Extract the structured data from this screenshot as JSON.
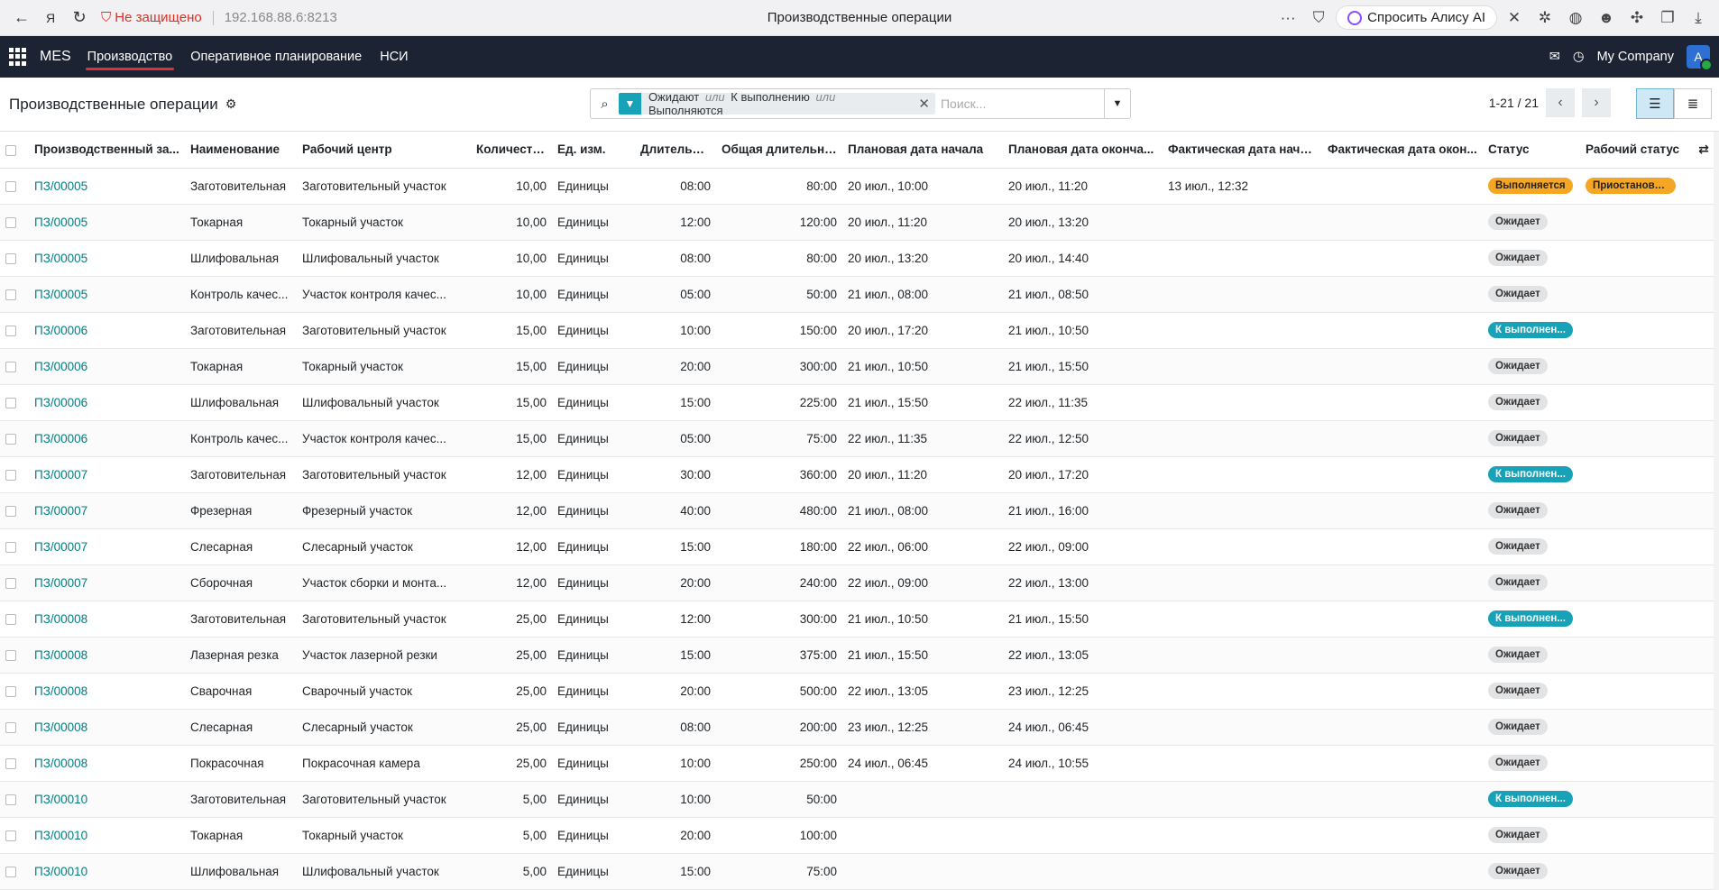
{
  "browser": {
    "not_secure": "Не защищено",
    "url": "192.168.88.6:8213",
    "tab_title": "Производственные операции",
    "alice": "Спросить Алису AI"
  },
  "nav": {
    "brand": "MES",
    "items": [
      "Производство",
      "Оперативное планирование",
      "НСИ"
    ],
    "company": "My Company",
    "avatar": "A"
  },
  "control": {
    "title": "Производственные операции",
    "facet": [
      "Ожидают",
      "К выполнению",
      "Выполняются"
    ],
    "facet_or": "или",
    "search_placeholder": "Поиск...",
    "pager": "1-21 / 21"
  },
  "columns": [
    "Производственный за...",
    "Наименование",
    "Рабочий центр",
    "Количество",
    "Ед. изм.",
    "Длительно...",
    "Общая длительно...",
    "Плановая дата начала",
    "Плановая дата оконча...",
    "Фактическая дата начала",
    "Фактическая дата окон...",
    "Статус",
    "Рабочий статус"
  ],
  "rows": [
    {
      "order": "ПЗ/00005",
      "name": "Заготовительная",
      "wc": "Заготовительный участок",
      "qty": "10,00",
      "uom": "Единицы",
      "dur": "08:00",
      "total": "80:00",
      "ps": "20 июл., 10:00",
      "pe": "20 июл., 11:20",
      "as": "13 июл., 12:32",
      "ae": "",
      "status": "Выполняется",
      "st": "warn",
      "work": "Приостановл..."
    },
    {
      "order": "ПЗ/00005",
      "name": "Токарная",
      "wc": "Токарный участок",
      "qty": "10,00",
      "uom": "Единицы",
      "dur": "12:00",
      "total": "120:00",
      "ps": "20 июл., 11:20",
      "pe": "20 июл., 13:20",
      "as": "",
      "ae": "",
      "status": "Ожидает",
      "st": "muted",
      "work": ""
    },
    {
      "order": "ПЗ/00005",
      "name": "Шлифовальная",
      "wc": "Шлифовальный участок",
      "qty": "10,00",
      "uom": "Единицы",
      "dur": "08:00",
      "total": "80:00",
      "ps": "20 июл., 13:20",
      "pe": "20 июл., 14:40",
      "as": "",
      "ae": "",
      "status": "Ожидает",
      "st": "muted",
      "work": ""
    },
    {
      "order": "ПЗ/00005",
      "name": "Контроль качес...",
      "wc": "Участок контроля качес...",
      "qty": "10,00",
      "uom": "Единицы",
      "dur": "05:00",
      "total": "50:00",
      "ps": "21 июл., 08:00",
      "pe": "21 июл., 08:50",
      "as": "",
      "ae": "",
      "status": "Ожидает",
      "st": "muted",
      "work": ""
    },
    {
      "order": "ПЗ/00006",
      "name": "Заготовительная",
      "wc": "Заготовительный участок",
      "qty": "15,00",
      "uom": "Единицы",
      "dur": "10:00",
      "total": "150:00",
      "ps": "20 июл., 17:20",
      "pe": "21 июл., 10:50",
      "as": "",
      "ae": "",
      "status": "К выполнен...",
      "st": "info",
      "work": ""
    },
    {
      "order": "ПЗ/00006",
      "name": "Токарная",
      "wc": "Токарный участок",
      "qty": "15,00",
      "uom": "Единицы",
      "dur": "20:00",
      "total": "300:00",
      "ps": "21 июл., 10:50",
      "pe": "21 июл., 15:50",
      "as": "",
      "ae": "",
      "status": "Ожидает",
      "st": "muted",
      "work": ""
    },
    {
      "order": "ПЗ/00006",
      "name": "Шлифовальная",
      "wc": "Шлифовальный участок",
      "qty": "15,00",
      "uom": "Единицы",
      "dur": "15:00",
      "total": "225:00",
      "ps": "21 июл., 15:50",
      "pe": "22 июл., 11:35",
      "as": "",
      "ae": "",
      "status": "Ожидает",
      "st": "muted",
      "work": ""
    },
    {
      "order": "ПЗ/00006",
      "name": "Контроль качес...",
      "wc": "Участок контроля качес...",
      "qty": "15,00",
      "uom": "Единицы",
      "dur": "05:00",
      "total": "75:00",
      "ps": "22 июл., 11:35",
      "pe": "22 июл., 12:50",
      "as": "",
      "ae": "",
      "status": "Ожидает",
      "st": "muted",
      "work": ""
    },
    {
      "order": "ПЗ/00007",
      "name": "Заготовительная",
      "wc": "Заготовительный участок",
      "qty": "12,00",
      "uom": "Единицы",
      "dur": "30:00",
      "total": "360:00",
      "ps": "20 июл., 11:20",
      "pe": "20 июл., 17:20",
      "as": "",
      "ae": "",
      "status": "К выполнен...",
      "st": "info",
      "work": ""
    },
    {
      "order": "ПЗ/00007",
      "name": "Фрезерная",
      "wc": "Фрезерный участок",
      "qty": "12,00",
      "uom": "Единицы",
      "dur": "40:00",
      "total": "480:00",
      "ps": "21 июл., 08:00",
      "pe": "21 июл., 16:00",
      "as": "",
      "ae": "",
      "status": "Ожидает",
      "st": "muted",
      "work": ""
    },
    {
      "order": "ПЗ/00007",
      "name": "Слесарная",
      "wc": "Слесарный участок",
      "qty": "12,00",
      "uom": "Единицы",
      "dur": "15:00",
      "total": "180:00",
      "ps": "22 июл., 06:00",
      "pe": "22 июл., 09:00",
      "as": "",
      "ae": "",
      "status": "Ожидает",
      "st": "muted",
      "work": ""
    },
    {
      "order": "ПЗ/00007",
      "name": "Сборочная",
      "wc": "Участок сборки и монта...",
      "qty": "12,00",
      "uom": "Единицы",
      "dur": "20:00",
      "total": "240:00",
      "ps": "22 июл., 09:00",
      "pe": "22 июл., 13:00",
      "as": "",
      "ae": "",
      "status": "Ожидает",
      "st": "muted",
      "work": ""
    },
    {
      "order": "ПЗ/00008",
      "name": "Заготовительная",
      "wc": "Заготовительный участок",
      "qty": "25,00",
      "uom": "Единицы",
      "dur": "12:00",
      "total": "300:00",
      "ps": "21 июл., 10:50",
      "pe": "21 июл., 15:50",
      "as": "",
      "ae": "",
      "status": "К выполнен...",
      "st": "info",
      "work": ""
    },
    {
      "order": "ПЗ/00008",
      "name": "Лазерная резка",
      "wc": "Участок лазерной резки",
      "qty": "25,00",
      "uom": "Единицы",
      "dur": "15:00",
      "total": "375:00",
      "ps": "21 июл., 15:50",
      "pe": "22 июл., 13:05",
      "as": "",
      "ae": "",
      "status": "Ожидает",
      "st": "muted",
      "work": ""
    },
    {
      "order": "ПЗ/00008",
      "name": "Сварочная",
      "wc": "Сварочный участок",
      "qty": "25,00",
      "uom": "Единицы",
      "dur": "20:00",
      "total": "500:00",
      "ps": "22 июл., 13:05",
      "pe": "23 июл., 12:25",
      "as": "",
      "ae": "",
      "status": "Ожидает",
      "st": "muted",
      "work": ""
    },
    {
      "order": "ПЗ/00008",
      "name": "Слесарная",
      "wc": "Слесарный участок",
      "qty": "25,00",
      "uom": "Единицы",
      "dur": "08:00",
      "total": "200:00",
      "ps": "23 июл., 12:25",
      "pe": "24 июл., 06:45",
      "as": "",
      "ae": "",
      "status": "Ожидает",
      "st": "muted",
      "work": ""
    },
    {
      "order": "ПЗ/00008",
      "name": "Покрасочная",
      "wc": "Покрасочная камера",
      "qty": "25,00",
      "uom": "Единицы",
      "dur": "10:00",
      "total": "250:00",
      "ps": "24 июл., 06:45",
      "pe": "24 июл., 10:55",
      "as": "",
      "ae": "",
      "status": "Ожидает",
      "st": "muted",
      "work": ""
    },
    {
      "order": "ПЗ/00010",
      "name": "Заготовительная",
      "wc": "Заготовительный участок",
      "qty": "5,00",
      "uom": "Единицы",
      "dur": "10:00",
      "total": "50:00",
      "ps": "",
      "pe": "",
      "as": "",
      "ae": "",
      "status": "К выполнен...",
      "st": "info",
      "work": ""
    },
    {
      "order": "ПЗ/00010",
      "name": "Токарная",
      "wc": "Токарный участок",
      "qty": "5,00",
      "uom": "Единицы",
      "dur": "20:00",
      "total": "100:00",
      "ps": "",
      "pe": "",
      "as": "",
      "ae": "",
      "status": "Ожидает",
      "st": "muted",
      "work": ""
    },
    {
      "order": "ПЗ/00010",
      "name": "Шлифовальная",
      "wc": "Шлифовальный участок",
      "qty": "5,00",
      "uom": "Единицы",
      "dur": "15:00",
      "total": "75:00",
      "ps": "",
      "pe": "",
      "as": "",
      "ae": "",
      "status": "Ожидает",
      "st": "muted",
      "work": ""
    }
  ]
}
